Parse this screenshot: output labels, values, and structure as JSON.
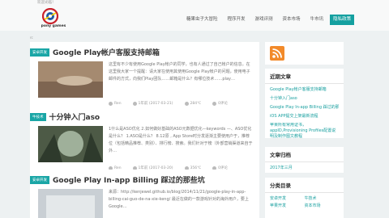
{
  "header": {
    "welcome": "欢迎光临！",
    "logo_text": "pony games",
    "nav": [
      "糖果虫子大冒险",
      "程序开发",
      "游戏评测",
      "资本市场",
      "牛市讯",
      "隐私政策"
    ]
  },
  "breadcrumb": "rc",
  "posts": [
    {
      "tag": "安卓开发",
      "title": "Google Play帐户客服支持邮箱",
      "excerpt": "这里有不少有使用Google Play帐户的同学，也有人通过了自己帐户的信息。在这里我大家一个提醒：请大家在使用其使用Google Play帐户的问题，使用电子邮件的方式，向我们Play团队……邮箱是什么？有哪位技术……play…",
      "author": "Ren",
      "date": "1年前 (2017-03-21)",
      "views": "284℃",
      "comments": "0评论"
    },
    {
      "tag": "牛技术",
      "title": "十分钟入门aso",
      "excerpt": "1什么是ASO优化 2.如何做好基础的ASO元数据优化—keywords —、ASO优化是什么？ 1.ASO是什么？ 8.12原 , App Store时分发逐渐主要使用户于，推荐位（包括精品推荐、类别）、排行榜、搜索。我们针对于榜（外部营销渠道来自于外…",
      "author": "Ren",
      "date": "1年前 (2017-03-20)",
      "views": "356℃",
      "comments": "0评论"
    },
    {
      "tag": "安卓开发",
      "title": "Google Play In-app Billing 踩过的那些坑",
      "excerpt": "来源：http://kenjewel.github.io/blog/2014/11/21/google-play-in-app-billing-cai-guo-de-na-xie-keng/ 最近在做的一款游戏针对的海外用户，要上Google…",
      "author": "",
      "date": "",
      "views": "",
      "comments": ""
    }
  ],
  "sidebar": {
    "recent_title": "近期文章",
    "recent": [
      "Google Play帐户客服支持邮箱",
      "十分钟入门aso",
      "Google Play In-app Billing 踩过的那些坑",
      "iOS APP提交上架最新流程",
      "苹果所有常用证书，appID,Provisioning Profiles配置说明及制作图文教程"
    ],
    "archive_title": "文章归档",
    "archive": [
      "2017年三月"
    ],
    "category_title": "分类目录",
    "categories": [
      "安卓开发",
      "牛技术",
      "苹果开发",
      "资本市场"
    ]
  },
  "colors": {
    "accent": "#1aa6a6",
    "rss": "#f28a2a"
  }
}
